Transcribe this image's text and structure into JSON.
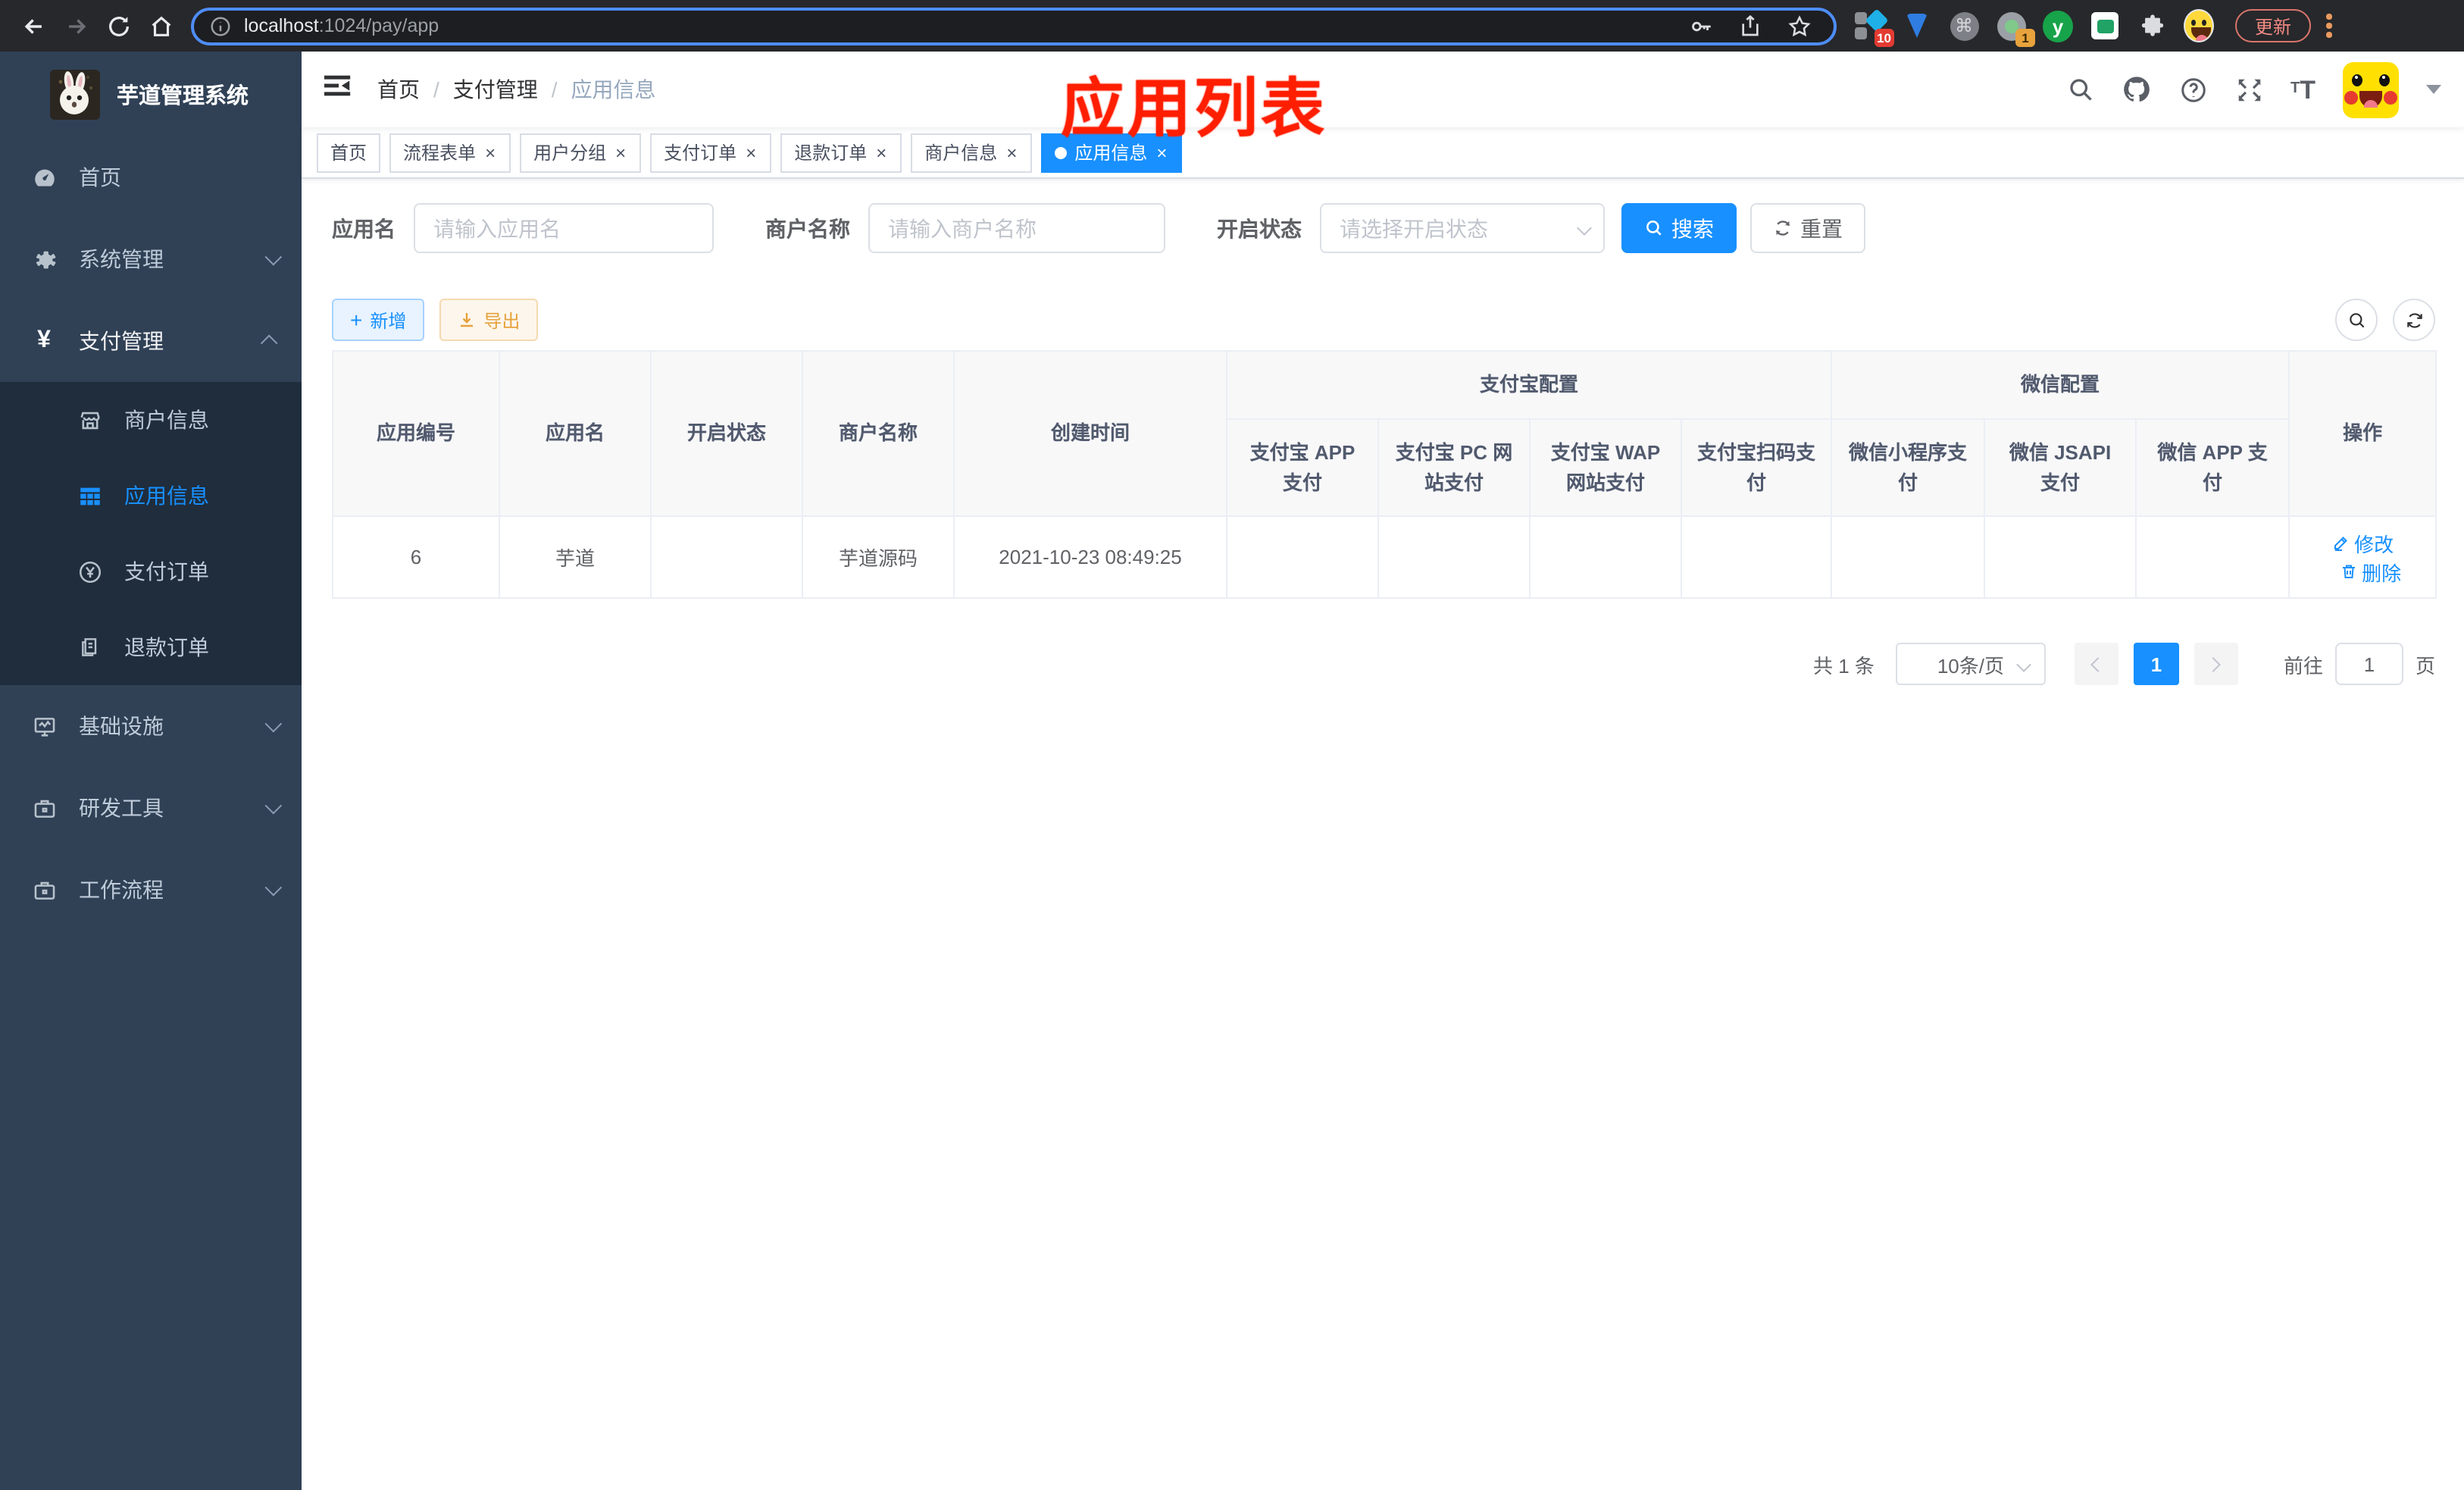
{
  "browser": {
    "url_host": "localhost",
    "url_rest": ":1024/pay/app",
    "update_label": "更新",
    "ext_badge_blocks": "10",
    "ext_badge_camera": "1",
    "ext_y_letter": "y",
    "cmd_glyph": "⌘"
  },
  "annotation": {
    "title": "应用列表"
  },
  "sidebar": {
    "logo_title": "芋道管理系统",
    "items": {
      "home": "首页",
      "system": "系统管理",
      "payment": "支付管理",
      "merchant_info": "商户信息",
      "app_info": "应用信息",
      "pay_order": "支付订单",
      "refund_order": "退款订单",
      "infrastructure": "基础设施",
      "dev_tools": "研发工具",
      "workflow": "工作流程"
    }
  },
  "navbar": {
    "breadcrumb": {
      "home": "首页",
      "section": "支付管理",
      "current": "应用信息",
      "separator": "/"
    }
  },
  "tabs": {
    "home": "首页",
    "flow_form": "流程表单",
    "user_group": "用户分组",
    "pay_order": "支付订单",
    "refund_order": "退款订单",
    "merchant_info": "商户信息",
    "app_info": "应用信息",
    "close_glyph": "×"
  },
  "filters": {
    "app_name_label": "应用名",
    "app_name_placeholder": "请输入应用名",
    "merchant_label": "商户名称",
    "merchant_placeholder": "请输入商户名称",
    "status_label": "开启状态",
    "status_placeholder": "请选择开启状态",
    "search_label": "搜索",
    "reset_label": "重置"
  },
  "toolbar": {
    "add_label": "新增",
    "export_label": "导出",
    "plus_glyph": "+"
  },
  "table": {
    "headers": {
      "app_id": "应用编号",
      "app_name": "应用名",
      "status": "开启状态",
      "merchant": "商户名称",
      "created": "创建时间",
      "alipay_group": "支付宝配置",
      "wechat_group": "微信配置",
      "actions": "操作",
      "sub": [
        "支付宝 APP 支付",
        "支付宝 PC 网站支付",
        "支付宝 WAP 网站支付",
        "支付宝扫码支付",
        "微信小程序支付",
        "微信 JSAPI 支付",
        "微信 APP 支付"
      ]
    },
    "row": {
      "app_id": "6",
      "app_name": "芋道",
      "enabled": true,
      "merchant": "芋道源码",
      "created": "2021-10-23 08:49:25",
      "pay_configs": [
        false,
        false,
        false,
        false,
        false,
        true,
        false
      ],
      "edit_label": "修改",
      "delete_label": "删除"
    }
  },
  "pagination": {
    "total": "共 1 条",
    "page_size": "10条/页",
    "current_page": "1",
    "goto_label": "前往",
    "goto_value": "1",
    "page_unit": "页"
  },
  "colors": {
    "theme": "#1890ff",
    "danger": "#f5494b",
    "success": "#0fce62",
    "sidebar": "#304156"
  }
}
